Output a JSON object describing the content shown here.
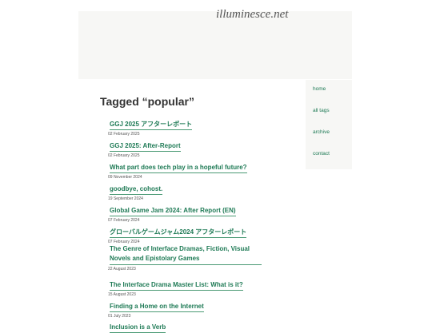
{
  "site": {
    "title": "illuminesce.net"
  },
  "nav": [
    {
      "label": "home"
    },
    {
      "label": "all tags"
    },
    {
      "label": "archive"
    },
    {
      "label": "contact"
    }
  ],
  "page": {
    "title": "Tagged “popular”"
  },
  "posts": [
    {
      "title": "GGJ 2025 アフターレポート",
      "date": "02 February 2025"
    },
    {
      "title": "GGJ 2025: After-Report",
      "date": "02 February 2025"
    },
    {
      "title": "What part does tech play in a hopeful future?",
      "date": "09 November 2024"
    },
    {
      "title": "goodbye, cohost.",
      "date": "19 September 2024"
    },
    {
      "title": "Global Game Jam 2024: After Report (EN)",
      "date": "07 February 2024"
    },
    {
      "title": "グローバルゲームジャム2024 アフターレポート",
      "date": "07 February 2024"
    },
    {
      "title": "The Genre of Interface Dramas, Fiction, Visual Novels and Epistolary Games",
      "date": "22 August 2023"
    },
    {
      "title": "The Interface Drama Master List: What is it?",
      "date": "15 August 2023"
    },
    {
      "title": "Finding a Home on the Internet",
      "date": "01 July 2023"
    },
    {
      "title": "Inclusion is a Verb",
      "date": ""
    }
  ]
}
